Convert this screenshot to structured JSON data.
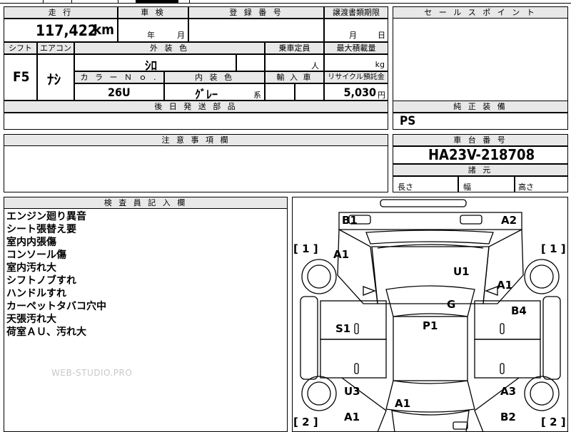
{
  "headers": {
    "mileage": "走 行",
    "inspection": "車 検",
    "registration": "登 録 番 号",
    "transfer_deadline": "譲渡書類期限",
    "selling_points": "セ ー ル ス ポ イ ン ト",
    "shift": "シフト",
    "aircon": "エアコン",
    "exterior_color": "外 装 色",
    "capacity": "乗車定員",
    "max_load": "最大積載量",
    "color_no": "カ ラ ー Ｎ ｏ .",
    "interior_color": "内 装 色",
    "import": "輸 入 車",
    "recycle": "リサイクル預託金",
    "later_parts": "後 日 発 送 部 品",
    "genuine_equipment": "純 正 装 備",
    "notes": "注 意 事 項 欄",
    "chassis_no": "車 台 番 号",
    "specs": "諸 元",
    "inspector_notes": "検 査 員 記 入 欄"
  },
  "values": {
    "mileage": "117,422",
    "mileage_unit": "km",
    "year_unit": "年",
    "month_unit": "月",
    "deadline_month": "月",
    "deadline_day": "日",
    "shift": "F5",
    "aircon": "ﾅｼ",
    "exterior_color": "ｼﾛ",
    "capacity_unit": "人",
    "load_unit": "kg",
    "color_no": "26U",
    "interior_color": "ｸﾞﾚｰ",
    "interior_suffix": "系",
    "recycle": "5,030",
    "recycle_unit": "円",
    "genuine_equipment": "PS",
    "chassis_no": "HA23V-218708",
    "length_label": "長さ",
    "width_label": "幅",
    "height_label": "高さ"
  },
  "inspector_notes": [
    "エンジン廻り異音",
    "シート張替え要",
    "室内内張傷",
    "コンソール傷",
    "室内汚れ大",
    "シフトノブすれ",
    "ハンドルすれ",
    "カーペットタバコ穴中",
    "天張汚れ大",
    "荷室ＡＵ、汚れ大"
  ],
  "damage_marks": {
    "b1": "B1",
    "a2": "A2",
    "a1_left_front": "A1",
    "u1": "U1",
    "a1_right_front": "A1",
    "g": "G",
    "b4": "B4",
    "s1": "S1",
    "p1": "P1",
    "u3": "U3",
    "a3": "A3",
    "a1_rear_center": "A1",
    "a1_left_rear": "A1",
    "b2": "B2",
    "tire_fl": "[ 1 ]",
    "tire_fr": "[ 1 ]",
    "tire_rl": "[ 2 ]",
    "tire_rr": "[ 2 ]"
  },
  "watermark": "WEB-STUDIO.PRO"
}
